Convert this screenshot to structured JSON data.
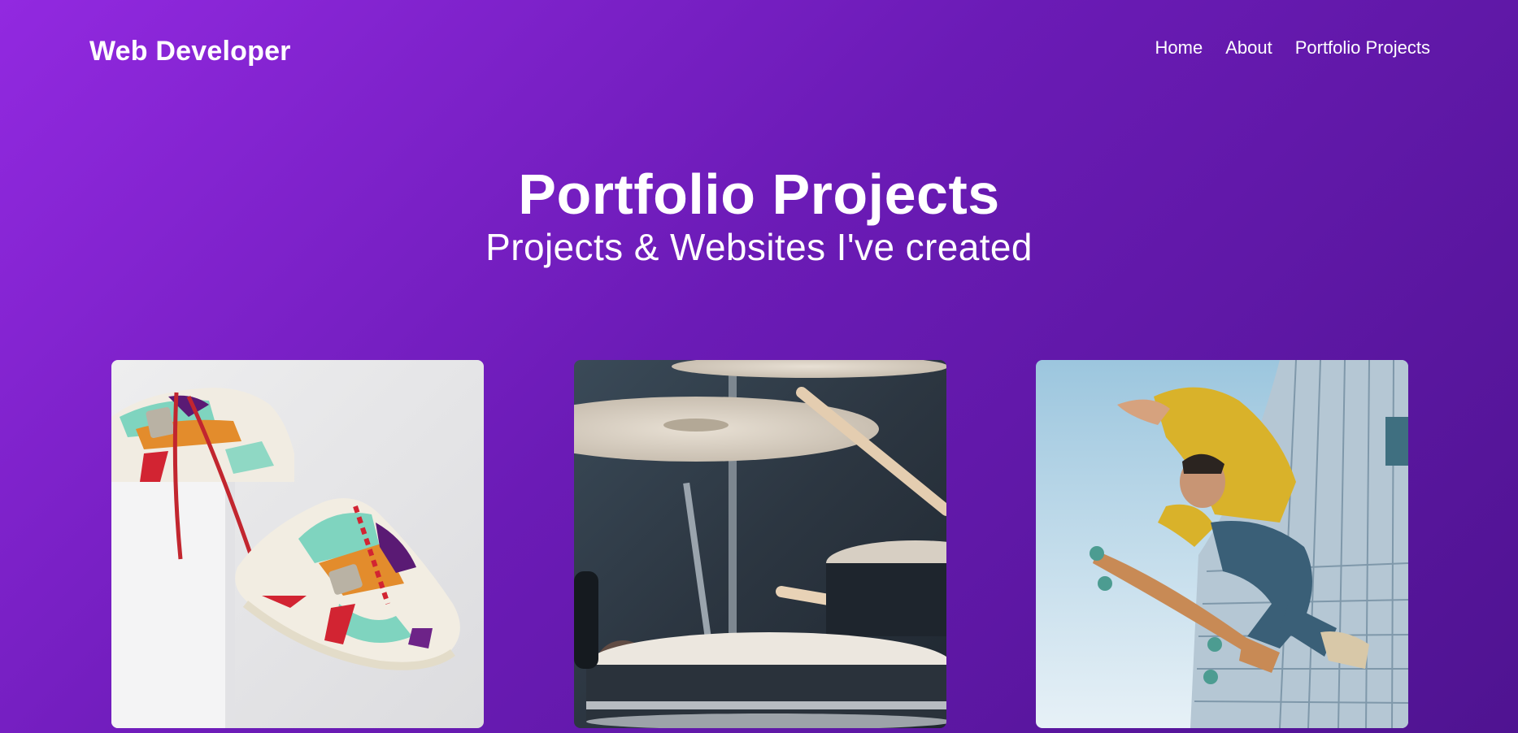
{
  "header": {
    "brand": "Web Developer",
    "nav": [
      {
        "label": "Home"
      },
      {
        "label": "About"
      },
      {
        "label": "Portfolio Projects"
      }
    ]
  },
  "hero": {
    "title": "Portfolio Projects",
    "subtitle": "Projects & Websites I've created"
  },
  "projects": [
    {
      "image": "sneakers-photo"
    },
    {
      "image": "drum-kit-photo"
    },
    {
      "image": "skateboarder-photo"
    }
  ],
  "colors": {
    "gradient_start": "#9229e0",
    "gradient_mid": "#6b1bb6",
    "gradient_end": "#4f1391",
    "text": "#ffffff"
  }
}
